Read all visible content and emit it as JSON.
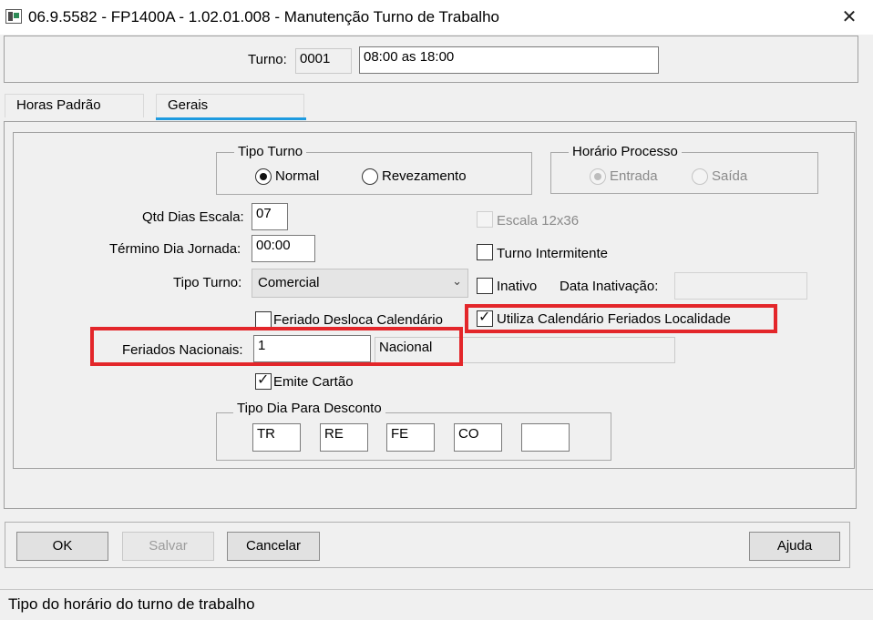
{
  "window": {
    "title": "06.9.5582 - FP1400A - 1.02.01.008 - Manutenção Turno de Trabalho",
    "close_glyph": "✕"
  },
  "header": {
    "turno_label": "Turno:",
    "turno_code": "0001",
    "turno_desc": "08:00 as 18:00"
  },
  "tabs": [
    {
      "label": "Horas Padrão",
      "selected": false
    },
    {
      "label": "Gerais",
      "selected": true
    }
  ],
  "tipo_turno_group": {
    "legend": "Tipo Turno",
    "options": [
      {
        "label": "Normal",
        "checked": true
      },
      {
        "label": "Revezamento",
        "checked": false
      }
    ]
  },
  "horario_processo_group": {
    "legend": "Horário Processo",
    "options": [
      {
        "label": "Entrada",
        "checked": true,
        "disabled": true
      },
      {
        "label": "Saída",
        "checked": false,
        "disabled": true
      }
    ]
  },
  "fields": {
    "qtd_dias_escala_label": "Qtd Dias Escala:",
    "qtd_dias_escala_value": "07",
    "termino_dia_jornada_label": "Término Dia Jornada:",
    "termino_dia_jornada_value": "00:00",
    "tipo_turno_label": "Tipo Turno:",
    "tipo_turno_value": "Comercial",
    "feriados_nacionais_label": "Feriados Nacionais:",
    "feriados_nacionais_value": "1",
    "feriados_nacionais_desc": "Nacional",
    "data_inativacao_label": "Data Inativação:",
    "data_inativacao_value": ""
  },
  "checkboxes": {
    "escala_12x36": {
      "label": "Escala 12x36",
      "checked": false,
      "disabled": true
    },
    "turno_intermitente": {
      "label": "Turno Intermitente",
      "checked": false
    },
    "inativo": {
      "label": "Inativo",
      "checked": false
    },
    "utiliza_calendario": {
      "label": "Utiliza Calendário Feriados Localidade",
      "checked": true
    },
    "feriado_desloca": {
      "label": "Feriado Desloca Calendário",
      "checked": false
    },
    "emite_cartao": {
      "label": "Emite Cartão",
      "checked": true
    }
  },
  "tipo_dia_desconto": {
    "legend": "Tipo Dia Para Desconto",
    "values": [
      "TR",
      "RE",
      "FE",
      "CO",
      ""
    ]
  },
  "buttons": {
    "ok": "OK",
    "salvar": "Salvar",
    "cancelar": "Cancelar",
    "ajuda": "Ajuda"
  },
  "status_bar": {
    "text": "Tipo do horário do turno de trabalho"
  },
  "colors": {
    "highlight": "#e3262a",
    "tab_accent": "#1e9be0"
  }
}
